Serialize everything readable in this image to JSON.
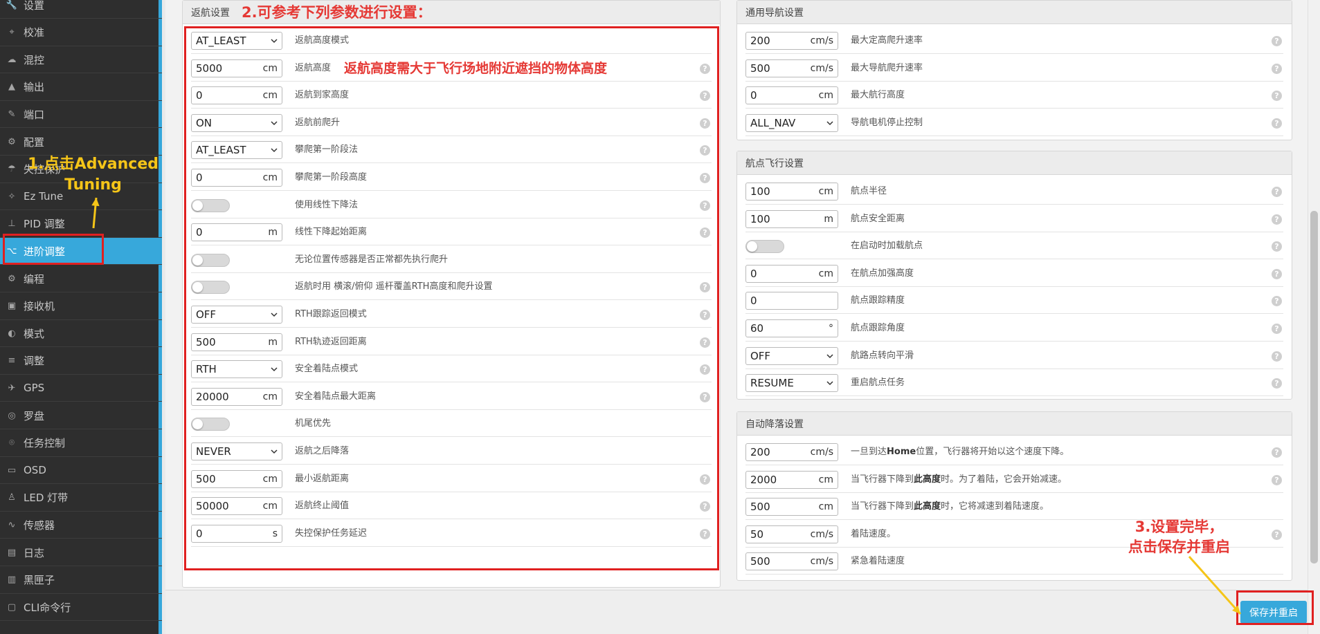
{
  "sidebar": {
    "items": [
      {
        "icon": "wrench-icon",
        "label": "设置"
      },
      {
        "icon": "crosshair-icon",
        "label": "校准"
      },
      {
        "icon": "mixer-icon",
        "label": "混控"
      },
      {
        "icon": "output-icon",
        "label": "输出"
      },
      {
        "icon": "plug-icon",
        "label": "端口"
      },
      {
        "icon": "gear-icon",
        "label": "配置"
      },
      {
        "icon": "parachute-icon",
        "label": "失控保护"
      },
      {
        "icon": "wand-icon",
        "label": "Ez Tune"
      },
      {
        "icon": "tree-icon",
        "label": "PID 调整"
      },
      {
        "icon": "branch-icon",
        "label": "进阶调整"
      },
      {
        "icon": "cog-icon",
        "label": "编程"
      },
      {
        "icon": "receiver-icon",
        "label": "接收机"
      },
      {
        "icon": "toggle-icon",
        "label": "模式"
      },
      {
        "icon": "sliders-icon",
        "label": "调整"
      },
      {
        "icon": "satellite-icon",
        "label": "GPS"
      },
      {
        "icon": "compass-icon",
        "label": "罗盘"
      },
      {
        "icon": "map-pin-icon",
        "label": "任务控制"
      },
      {
        "icon": "osd-icon",
        "label": "OSD"
      },
      {
        "icon": "led-icon",
        "label": "LED 灯带"
      },
      {
        "icon": "pulse-icon",
        "label": "传感器"
      },
      {
        "icon": "log-icon",
        "label": "日志"
      },
      {
        "icon": "blackbox-icon",
        "label": "黑匣子"
      },
      {
        "icon": "cli-icon",
        "label": "CLI命令行"
      }
    ],
    "active_index": 9
  },
  "rth": {
    "title": "返航设置",
    "rows": [
      {
        "type": "select",
        "value": "AT_LEAST",
        "label": "返航高度模式",
        "help": false
      },
      {
        "type": "input",
        "value": "5000",
        "unit": "cm",
        "label": "返航高度",
        "help": true
      },
      {
        "type": "input",
        "value": "0",
        "unit": "cm",
        "label": "返航到家高度",
        "help": true
      },
      {
        "type": "select",
        "value": "ON",
        "label": "返航前爬升",
        "help": true
      },
      {
        "type": "select",
        "value": "AT_LEAST",
        "label": "攀爬第一阶段法",
        "help": true
      },
      {
        "type": "input",
        "value": "0",
        "unit": "cm",
        "label": "攀爬第一阶段高度",
        "help": true
      },
      {
        "type": "toggle",
        "on": false,
        "label": "使用线性下降法",
        "help": true
      },
      {
        "type": "input",
        "value": "0",
        "unit": "m",
        "label": "线性下降起始距离",
        "help": true
      },
      {
        "type": "toggle",
        "on": false,
        "label": "无论位置传感器是否正常都先执行爬升",
        "help": false
      },
      {
        "type": "toggle",
        "on": false,
        "label": "返航时用 横滚/俯仰 遥杆覆盖RTH高度和爬升设置",
        "help": true
      },
      {
        "type": "select",
        "value": "OFF",
        "label": "RTH跟踪返回模式",
        "help": true
      },
      {
        "type": "input",
        "value": "500",
        "unit": "m",
        "label": "RTH轨迹返回距离",
        "help": true
      },
      {
        "type": "select",
        "value": "RTH",
        "label": "安全着陆点模式",
        "help": true
      },
      {
        "type": "input",
        "value": "20000",
        "unit": "cm",
        "label": "安全着陆点最大距离",
        "help": true
      },
      {
        "type": "toggle",
        "on": false,
        "label": "机尾优先",
        "help": false
      },
      {
        "type": "select",
        "value": "NEVER",
        "label": "返航之后降落",
        "help": false
      },
      {
        "type": "input",
        "value": "500",
        "unit": "cm",
        "label": "最小返航距离",
        "help": true
      },
      {
        "type": "input",
        "value": "50000",
        "unit": "cm",
        "label": "返航终止阈值",
        "help": true
      },
      {
        "type": "input",
        "value": "0",
        "unit": "s",
        "label": "失控保护任务延迟",
        "help": true
      }
    ]
  },
  "nav": {
    "title": "通用导航设置",
    "rows": [
      {
        "type": "input",
        "value": "200",
        "unit": "cm/s",
        "label": "最大定高爬升速率",
        "help": true
      },
      {
        "type": "input",
        "value": "500",
        "unit": "cm/s",
        "label": "最大导航爬升速率",
        "help": true
      },
      {
        "type": "input",
        "value": "0",
        "unit": "cm",
        "label": "最大航行高度",
        "help": true
      },
      {
        "type": "select",
        "value": "ALL_NAV",
        "label": "导航电机停止控制",
        "help": true
      }
    ]
  },
  "waypoint": {
    "title": "航点飞行设置",
    "rows": [
      {
        "type": "input",
        "value": "100",
        "unit": "cm",
        "label": "航点半径",
        "help": true
      },
      {
        "type": "input",
        "value": "100",
        "unit": "m",
        "label": "航点安全距离",
        "help": true
      },
      {
        "type": "toggle",
        "on": false,
        "label": "在启动时加载航点",
        "help": true
      },
      {
        "type": "input",
        "value": "0",
        "unit": "cm",
        "label": "在航点加强高度",
        "help": true
      },
      {
        "type": "input",
        "value": "0",
        "unit": "",
        "label": "航点跟踪精度",
        "help": true
      },
      {
        "type": "input",
        "value": "60",
        "unit": "°",
        "label": "航点跟踪角度",
        "help": true
      },
      {
        "type": "select",
        "value": "OFF",
        "label": "航路点转向平滑",
        "help": true
      },
      {
        "type": "select",
        "value": "RESUME",
        "label": "重启航点任务",
        "help": true
      }
    ]
  },
  "landing": {
    "title": "自动降落设置",
    "rows": [
      {
        "type": "input",
        "value": "200",
        "unit": "cm/s",
        "label_pre": "一旦到达",
        "label_bold": "Home",
        "label_post": "位置，飞行器将开始以这个速度下降。",
        "help": true
      },
      {
        "type": "input",
        "value": "2000",
        "unit": "cm",
        "label_pre": "当飞行器下降到",
        "label_bold": "此高度",
        "label_post": "时。为了着陆，它会开始减速。",
        "help": true
      },
      {
        "type": "input",
        "value": "500",
        "unit": "cm",
        "label_pre": "当飞行器下降到",
        "label_bold": "此高度",
        "label_post": "时，它将减速到着陆速度。",
        "help": false
      },
      {
        "type": "input",
        "value": "50",
        "unit": "cm/s",
        "label": "着陆速度。",
        "help": true
      },
      {
        "type": "input",
        "value": "500",
        "unit": "cm/s",
        "label": "紧急着陆速度",
        "help": false
      }
    ]
  },
  "save_button": "保存并重启",
  "annotations": {
    "step1": "1.点击Advanced\nTuning",
    "step2": "2.可参考下列参数进行设置：",
    "altitude_note": "返航高度需大于飞行场地附近遮挡的物体高度",
    "step3": "3.设置完毕，\n点击保存并重启"
  },
  "colors": {
    "accent": "#37a8db",
    "annotation_red": "#e02020",
    "annotation_yellow": "#f5c518",
    "sidebar_bg": "#2e2e2e"
  }
}
